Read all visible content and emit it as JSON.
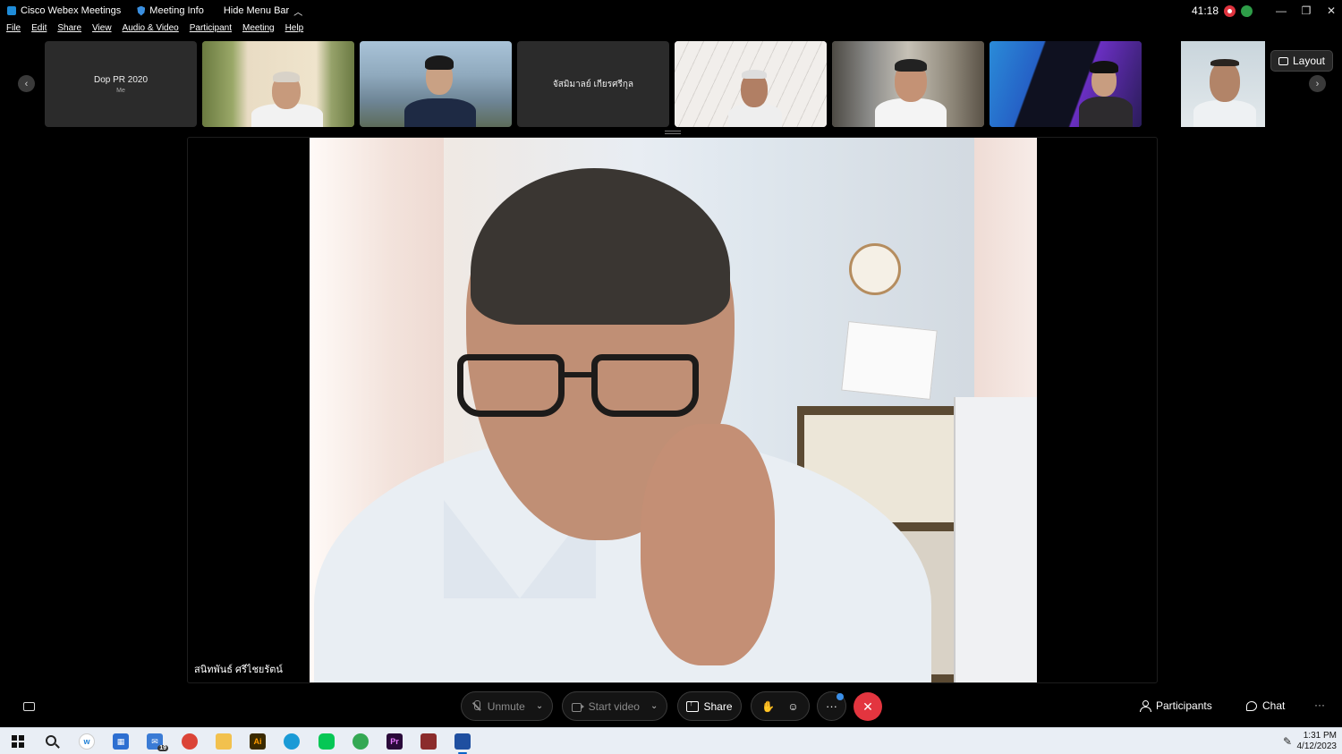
{
  "titlebar": {
    "app_title": "Cisco Webex Meetings",
    "meeting_info": "Meeting Info",
    "hide_menu": "Hide Menu Bar",
    "timer": "41:18"
  },
  "menu": [
    "File",
    "Edit",
    "Share",
    "View",
    "Audio & Video",
    "Participant",
    "Meeting",
    "Help"
  ],
  "thumbnails": [
    {
      "name": "Dop PR 2020",
      "sub": "Me",
      "kind": "name"
    },
    {
      "kind": "video",
      "bg": "#7e8a5c"
    },
    {
      "kind": "video",
      "bg": "#7a8f9f"
    },
    {
      "name": "จัสมิมาลย์ เกียรศรีกุล",
      "kind": "name"
    },
    {
      "kind": "video",
      "bg": "#ece9e6"
    },
    {
      "kind": "video",
      "bg": "#8a8073"
    },
    {
      "kind": "video",
      "bg": "#2f5fb4"
    },
    {
      "kind": "video",
      "bg": "#cfd8dc"
    }
  ],
  "layout_label": "Layout",
  "active_speaker": "สนิทพันธ์ ศรีไชยรัตน์",
  "controls": {
    "unmute": "Unmute",
    "start_video": "Start video",
    "share": "Share",
    "participants": "Participants",
    "chat": "Chat"
  },
  "taskbar": {
    "time": "1:31 PM",
    "date": "4/12/2023",
    "mail_badge": "19"
  },
  "colors": {
    "end_call": "#e3353f",
    "accent": "#3b8fe8",
    "recording": "#e0343f"
  }
}
